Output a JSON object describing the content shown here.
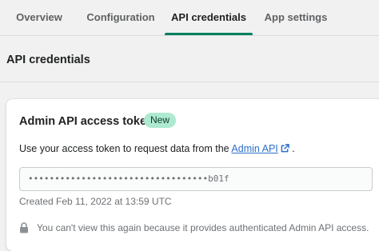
{
  "tabs": [
    {
      "label": "Overview"
    },
    {
      "label": "Configuration"
    },
    {
      "label": "API credentials",
      "active": true
    },
    {
      "label": "App settings"
    }
  ],
  "page": {
    "title": "API credentials"
  },
  "card": {
    "title": "Admin API access token",
    "badge": "New",
    "description_prefix": "Use your access token to request data from the ",
    "description_link": "Admin API",
    "description_suffix": " .",
    "token_masked": "••••••••••••••••••••••••••••••••••b01f",
    "created": "Created Feb 11, 2022 at 13:59 UTC",
    "warning": "You can't view this again because it provides authenticated Admin API access."
  },
  "colors": {
    "accent": "#008060",
    "badge_bg": "#aee9d1",
    "link": "#2c6ecb"
  },
  "icons": {
    "link_icon": "external-link-icon",
    "warning_icon": "lock-icon"
  }
}
